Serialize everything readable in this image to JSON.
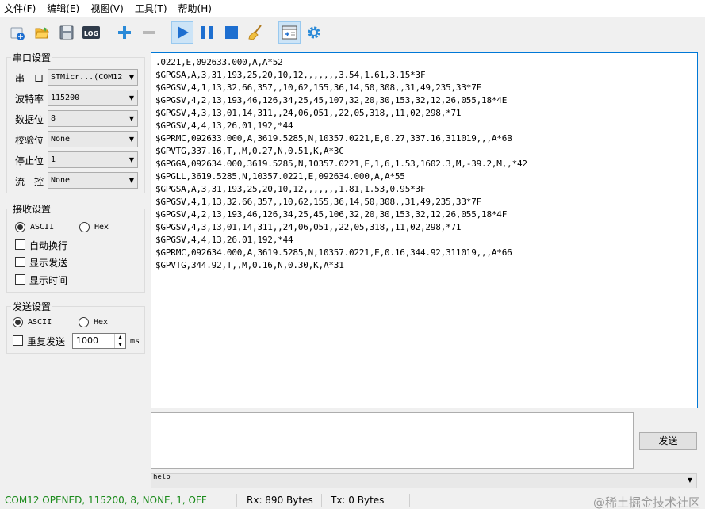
{
  "menu": [
    "文件(F)",
    "编辑(E)",
    "视图(V)",
    "工具(T)",
    "帮助(H)"
  ],
  "toolbar": {
    "icons": [
      "new-connection-icon",
      "open-folder-icon",
      "save-icon",
      "log-icon",
      "add-icon",
      "remove-icon",
      "play-icon",
      "pause-icon",
      "stop-icon",
      "clear-broom-icon",
      "window-layout-icon",
      "settings-gear-icon"
    ],
    "log_label": "LOG"
  },
  "serial_settings": {
    "title": "串口设置",
    "port_label": "串　口",
    "port_value": "STMicr...(COM12",
    "baud_label": "波特率",
    "baud_value": "115200",
    "databits_label": "数据位",
    "databits_value": "8",
    "parity_label": "校验位",
    "parity_value": "None",
    "stopbits_label": "停止位",
    "stopbits_value": "1",
    "flow_label": "流　控",
    "flow_value": "None"
  },
  "receive_settings": {
    "title": "接收设置",
    "ascii_label": "ASCII",
    "hex_label": "Hex",
    "mode_selected": "ASCII",
    "auto_wrap_label": "自动换行",
    "show_send_label": "显示发送",
    "show_time_label": "显示时间"
  },
  "send_settings": {
    "title": "发送设置",
    "ascii_label": "ASCII",
    "hex_label": "Hex",
    "mode_selected": "ASCII",
    "repeat_label": "重复发送",
    "interval_value": "1000",
    "interval_unit": "ms"
  },
  "receive_lines": [
    ".0221,E,092633.000,A,A*52",
    "$GPGSA,A,3,31,193,25,20,10,12,,,,,,,3.54,1.61,3.15*3F",
    "$GPGSV,4,1,13,32,66,357,,10,62,155,36,14,50,308,,31,49,235,33*7F",
    "$GPGSV,4,2,13,193,46,126,34,25,45,107,32,20,30,153,32,12,26,055,18*4E",
    "$GPGSV,4,3,13,01,14,311,,24,06,051,,22,05,318,,11,02,298,*71",
    "$GPGSV,4,4,13,26,01,192,*44",
    "$GPRMC,092633.000,A,3619.5285,N,10357.0221,E,0.27,337.16,311019,,,A*6B",
    "$GPVTG,337.16,T,,M,0.27,N,0.51,K,A*3C",
    "$GPGGA,092634.000,3619.5285,N,10357.0221,E,1,6,1.53,1602.3,M,-39.2,M,,*42",
    "$GPGLL,3619.5285,N,10357.0221,E,092634.000,A,A*55",
    "$GPGSA,A,3,31,193,25,20,10,12,,,,,,,1.81,1.53,0.95*3F",
    "$GPGSV,4,1,13,32,66,357,,10,62,155,36,14,50,308,,31,49,235,33*7F",
    "$GPGSV,4,2,13,193,46,126,34,25,45,106,32,20,30,153,32,12,26,055,18*4F",
    "$GPGSV,4,3,13,01,14,311,,24,06,051,,22,05,318,,11,02,298,*71",
    "$GPGSV,4,4,13,26,01,192,*44",
    "$GPRMC,092634.000,A,3619.5285,N,10357.0221,E,0.16,344.92,311019,,,A*66",
    "$GPVTG,344.92,T,,M,0.16,N,0.30,K,A*31"
  ],
  "send": {
    "button_label": "发送",
    "input_value": "",
    "help_value": "help"
  },
  "status": {
    "connection": "COM12 OPENED, 115200, 8, NONE, 1, OFF",
    "rx": "Rx: 890 Bytes",
    "tx": "Tx: 0 Bytes",
    "watermark": "@稀土掘金技术社区"
  },
  "colors": {
    "status_connection": "#1a8a1a",
    "accent_blue": "#1e6fd0",
    "receive_border": "#0078d7"
  }
}
